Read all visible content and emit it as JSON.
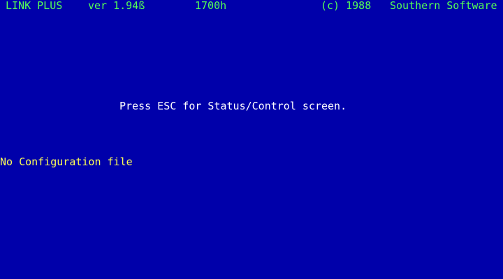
{
  "header": {
    "product": "LINK PLUS",
    "version": "ver 1.94ß",
    "address": "1700h",
    "copyright": "(c) 1988",
    "company": "Southern Software"
  },
  "main": {
    "prompt": "Press ESC for Status/Control screen.",
    "status": "No Configuration file"
  },
  "colors": {
    "background": "#0000aa",
    "header_text": "#55ff55",
    "prompt_text": "#ffffff",
    "status_text": "#ffff55"
  }
}
